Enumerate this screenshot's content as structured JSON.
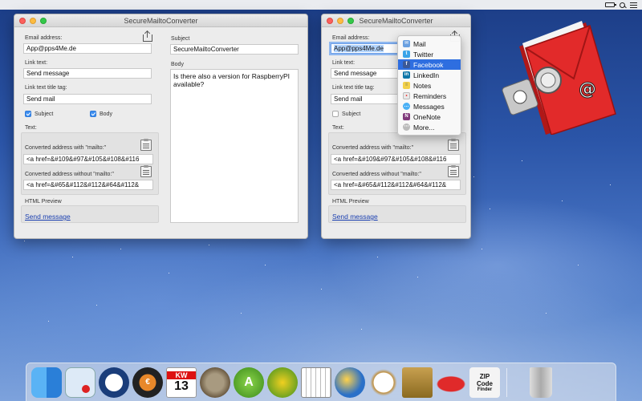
{
  "menubar": {
    "apple_glyph": "",
    "icons": [
      "battery-icon",
      "spotlight-search-icon",
      "notification-center-icon"
    ]
  },
  "app_title": "SecureMailtoConverter",
  "left_window": {
    "email_label": "Email address:",
    "email_value": "App@pps4Me.de",
    "link_text_label": "Link text:",
    "link_text_value": "Send message",
    "title_tag_label": "Link text title tag:",
    "title_tag_value": "Send mail",
    "subject_check_label": "Subject",
    "body_check_label": "Body",
    "text_section_label": "Text:",
    "conv_with_label": "Converted address with \"mailto:\"",
    "conv_with_value": "<a href=&#109&#97&#105&#108&#116",
    "conv_without_label": "Converted address without \"mailto:\"",
    "conv_without_value": "<a href=&#65&#112&#112&#64&#112&",
    "preview_label": "HTML Preview",
    "preview_link": "Send message",
    "subject_label": "Subject",
    "subject_value": "SecureMailtoConverter",
    "body_label": "Body",
    "body_value": "Is there also a version for RaspberryPI available?"
  },
  "right_window": {
    "email_label": "Email address:",
    "email_value": "App@pps4Me.de",
    "link_text_label": "Link text:",
    "link_text_value": "Send message",
    "title_tag_label": "Link text title tag:",
    "title_tag_value": "Send mail",
    "subject_check_label": "Subject",
    "text_section_label": "Text:",
    "conv_with_label": "Converted address with \"mailto:\"",
    "conv_with_value": "<a href=&#109&#97&#105&#108&#116",
    "conv_without_label": "Converted address without \"mailto:\"",
    "conv_without_value": "<a href=&#65&#112&#112&#64&#112&",
    "preview_label": "HTML Preview",
    "preview_link": "Send message"
  },
  "share_menu": {
    "items": [
      {
        "label": "Mail",
        "icon": "mail-icon",
        "color": "#6aa0e0"
      },
      {
        "label": "Twitter",
        "icon": "twitter-icon",
        "color": "#3aa4e8"
      },
      {
        "label": "Facebook",
        "icon": "facebook-icon",
        "color": "#3b5998"
      },
      {
        "label": "LinkedIn",
        "icon": "linkedin-icon",
        "color": "#0e76a8"
      },
      {
        "label": "Notes",
        "icon": "notes-icon",
        "color": "#f2d04a"
      },
      {
        "label": "Reminders",
        "icon": "reminders-icon",
        "color": "#e9e9e9"
      },
      {
        "label": "Messages",
        "icon": "messages-icon",
        "color": "#4ab0f5"
      },
      {
        "label": "OneNote",
        "icon": "onenote-icon",
        "color": "#80397b"
      },
      {
        "label": "More...",
        "icon": "more-icon",
        "color": "#bbbbbb"
      }
    ],
    "active": "Facebook"
  },
  "dock": {
    "kw_label": "KW",
    "kw_number": "13",
    "zip_label": "ZIP",
    "code_label": "Code",
    "finder_label": "Finder"
  },
  "colors": {
    "accent": "#2e6ee0",
    "link": "#1a3fb0",
    "checkbox": "#3d8ef0"
  }
}
